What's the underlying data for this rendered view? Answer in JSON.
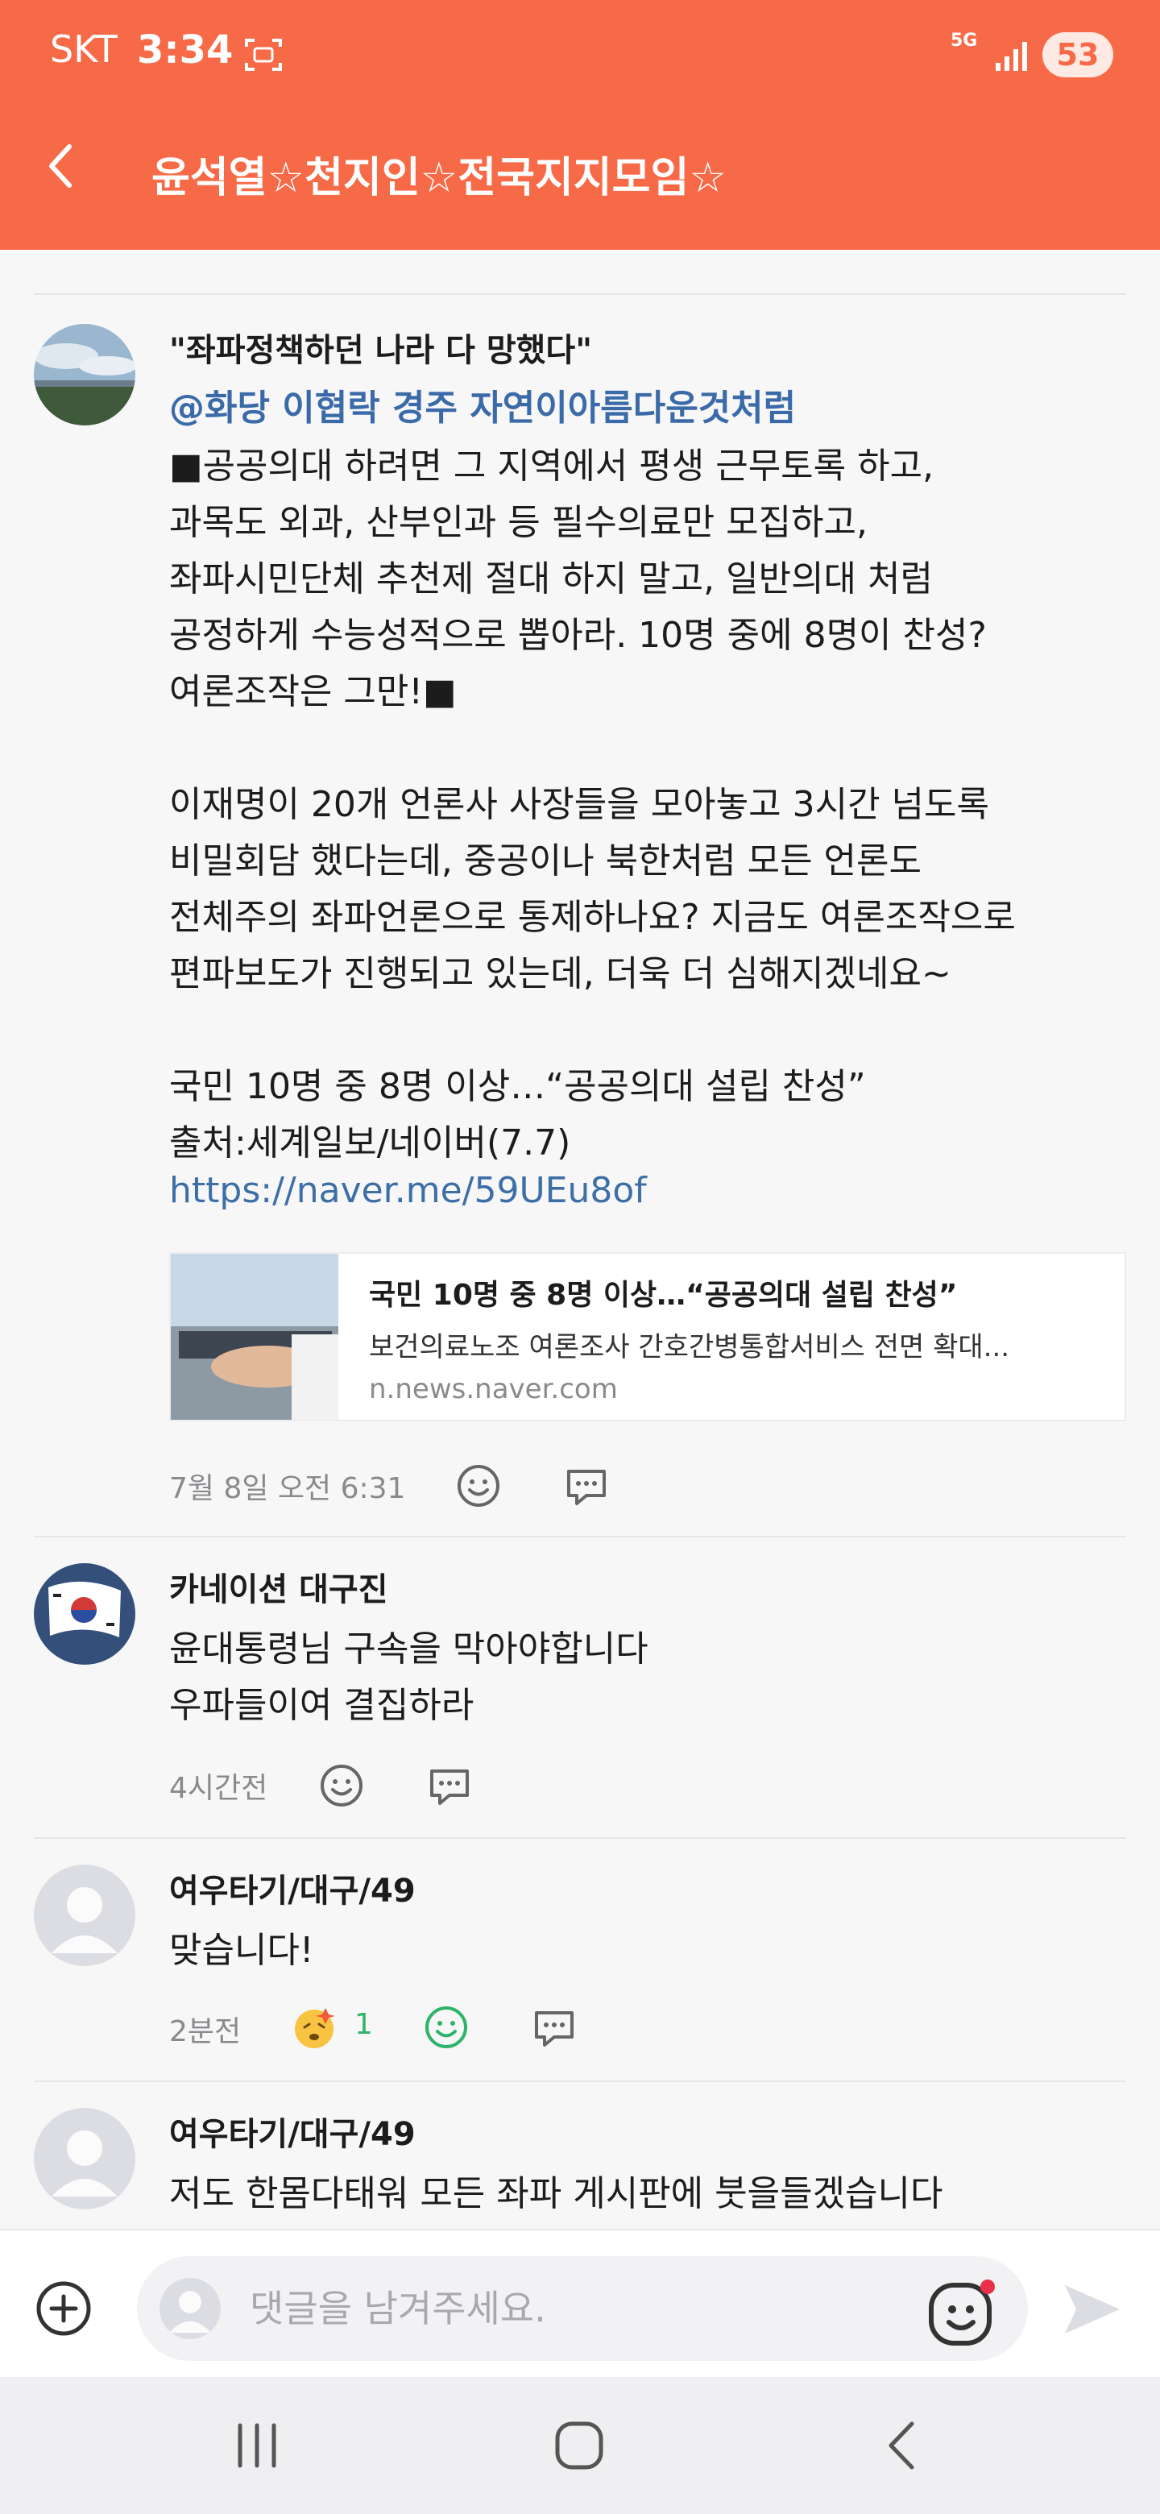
{
  "status_bar": {
    "carrier": "SKT",
    "time": "3:34",
    "network": "5G",
    "battery": "53"
  },
  "header": {
    "title": "윤석열☆천지인☆전국지지모임☆"
  },
  "posts": [
    {
      "author": "\"좌파정책하던 나라 다 망했다\"",
      "mention": "@화당  이협락  경주    자연이아름다운것처럼",
      "lines": [
        "■공공의대 하려면 그 지역에서 평생 근무토록 하고,",
        "과목도 외과, 산부인과 등 필수의료만 모집하고,",
        "좌파시민단체 추천제 절대 하지 말고, 일반의대 처럼",
        "공정하게 수능성적으로 뽑아라. 10명 중에 8명이 찬성?",
        "여론조작은 그만!■",
        "이재명이 20개 언론사 사장들을 모아놓고 3시간 넘도록",
        "비밀회담 했다는데, 중공이나 북한처럼 모든 언론도",
        "전체주의 좌파언론으로 통제하나요? 지금도 여론조작으로",
        "편파보도가 진행되고 있는데, 더욱 더 심해지겠네요~",
        "국민 10명 중 8명 이상…“공공의대 설립 찬성”",
        "출처:세계일보/네이버(7.7)"
      ],
      "link": "https://naver.me/59UEu8of",
      "card": {
        "title": "국민 10명 중 8명 이상…“공공의대 설립 찬성”",
        "description": "보건의료노조 여론조사 간호간병통합서비스 전면 확대...",
        "domain": "n.news.naver.com"
      },
      "time": "7월 8일 오전 6:31"
    },
    {
      "author": "카네이션 대구진",
      "lines": [
        "윤대통령님 구속을 막아야합니다",
        "우파들이여 결집하라"
      ],
      "time": "4시간전"
    },
    {
      "author": "여우타기/대구/49",
      "lines": [
        "맞습니다!"
      ],
      "time": "2분전",
      "like_count": "1"
    },
    {
      "author": "여우타기/대구/49",
      "lines": [
        "저도 한몸다태워 모든 좌파 게시판에 붓을들겠습니다"
      ]
    }
  ],
  "composer": {
    "placeholder": "댓글을 남겨주세요."
  },
  "icons": {
    "back": "chevron-left-icon",
    "emoji": "smiley-icon",
    "comment": "speech-bubble-icon",
    "attach": "plus-circle-icon",
    "send": "send-arrow-icon"
  },
  "colors": {
    "header": "#f76a48",
    "link": "#3d6fa6",
    "mention": "#3a6aa8",
    "liked": "#2fb36a",
    "notification_dot": "#e8304a"
  }
}
